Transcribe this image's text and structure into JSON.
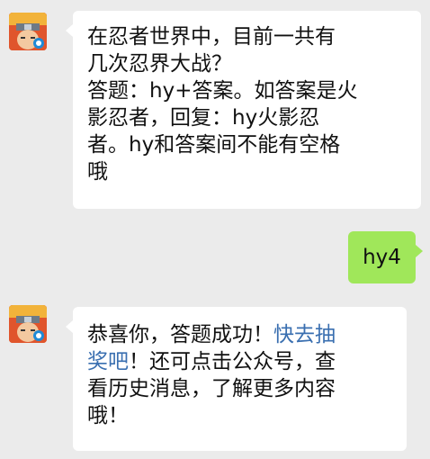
{
  "colors": {
    "background": "#ebebeb",
    "incoming_bubble": "#ffffff",
    "outgoing_bubble": "#a0e75a",
    "link": "#3a6fb0"
  },
  "messages": [
    {
      "sender": "official-account",
      "avatar_icon": "naruto-game-avatar-icon",
      "lines": [
        "在忍者世界中，目前一共有",
        "几次忍界大战？",
        "答题：hy+答案。如答案是火",
        "影忍者，回复：hy火影忍",
        "者。hy和答案间不能有空格",
        "哦"
      ]
    },
    {
      "sender": "me",
      "text": "hy4"
    },
    {
      "sender": "official-account",
      "avatar_icon": "naruto-game-avatar-icon",
      "line1_prefix": "恭喜你，答题成功！",
      "line1_link": "快去抽",
      "line2_link": "奖吧",
      "line2_suffix": "！还可点击公众号，查",
      "line3": "看历史消息，了解更多内容",
      "line4": "哦！"
    }
  ]
}
